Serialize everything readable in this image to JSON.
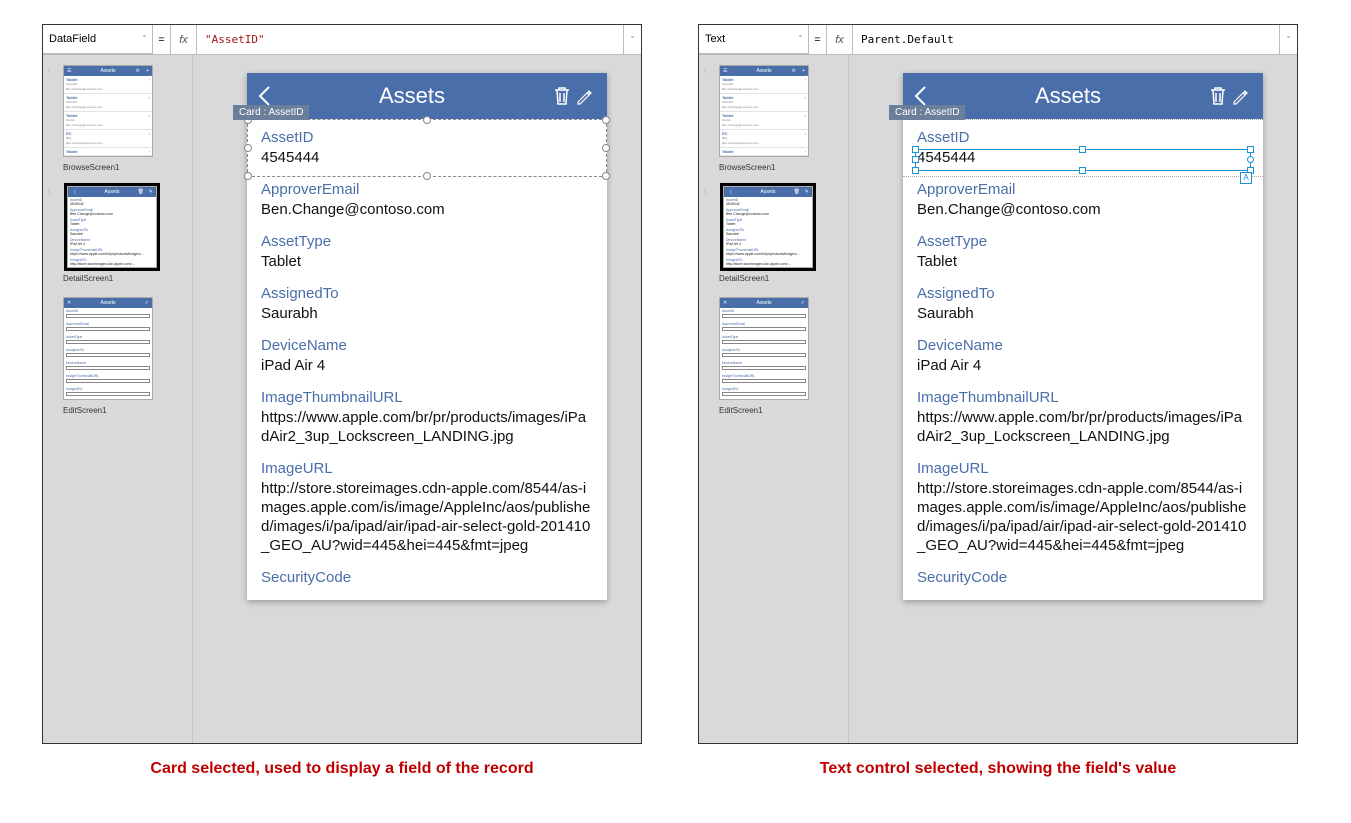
{
  "left": {
    "property_name": "DataField",
    "formula_quoted": "\"AssetID\"",
    "card_tag": "Card : AssetID"
  },
  "right": {
    "property_name": "Text",
    "formula_plain": "Parent.Default",
    "card_tag": "Card : AssetID"
  },
  "thumb_labels": {
    "browse": "BrowseScreen1",
    "detail": "DetailScreen1",
    "edit": "EditScreen1"
  },
  "browse_rows": [
    {
      "title": "Tablet",
      "sub": "Saurabh",
      "sub2": "Ben.Change@contoso.com"
    },
    {
      "title": "Tablet",
      "sub": "Saurabh",
      "sub2": "Ben.Change@contoso.com"
    },
    {
      "title": "Tablet",
      "sub": "Novita",
      "sub2": "Ben.Change@contoso.com"
    },
    {
      "title": "PC",
      "sub": "Billy",
      "sub2": "Ben.Change@contoso.com"
    },
    {
      "title": "Tablet",
      "sub": "",
      "sub2": ""
    }
  ],
  "phone": {
    "title": "Assets",
    "fields": [
      {
        "label": "AssetID",
        "value": "4545444"
      },
      {
        "label": "ApproverEmail",
        "value": "Ben.Change@contoso.com"
      },
      {
        "label": "AssetType",
        "value": "Tablet"
      },
      {
        "label": "AssignedTo",
        "value": "Saurabh"
      },
      {
        "label": "DeviceName",
        "value": "iPad Air 4"
      },
      {
        "label": "ImageThumbnailURL",
        "value": "https://www.apple.com/br/pr/products/images/iPadAir2_3up_Lockscreen_LANDING.jpg"
      },
      {
        "label": "ImageURL",
        "value": "http://store.storeimages.cdn-apple.com/8544/as-images.apple.com/is/image/AppleInc/aos/published/images/i/pa/ipad/air/ipad-air-select-gold-201410_GEO_AU?wid=445&hei=445&fmt=jpeg"
      },
      {
        "label": "SecurityCode",
        "value": ""
      }
    ]
  },
  "detail_fields_mini": [
    {
      "label": "AssetID",
      "value": "4545444"
    },
    {
      "label": "ApproverEmail",
      "value": "Ben.Change@contoso.com"
    },
    {
      "label": "AssetType",
      "value": "Tablet"
    },
    {
      "label": "AssignedTo",
      "value": "Saurabh"
    },
    {
      "label": "DeviceName",
      "value": "iPad Air 4"
    },
    {
      "label": "ImageThumbnailURL",
      "value": "https://www.apple.com/br/pr/products/images/..."
    },
    {
      "label": "ImageURL",
      "value": "http://store.storeimages.cdn-apple.com/..."
    }
  ],
  "edit_fields_mini": [
    "AssetID",
    "ApproverEmail",
    "AssetType",
    "AssignedTo",
    "DeviceName",
    "ImageThumbnailURL",
    "ImageURL"
  ],
  "captions": {
    "left": "Card selected, used to display a field of the record",
    "right": "Text control selected, showing the field's value"
  }
}
